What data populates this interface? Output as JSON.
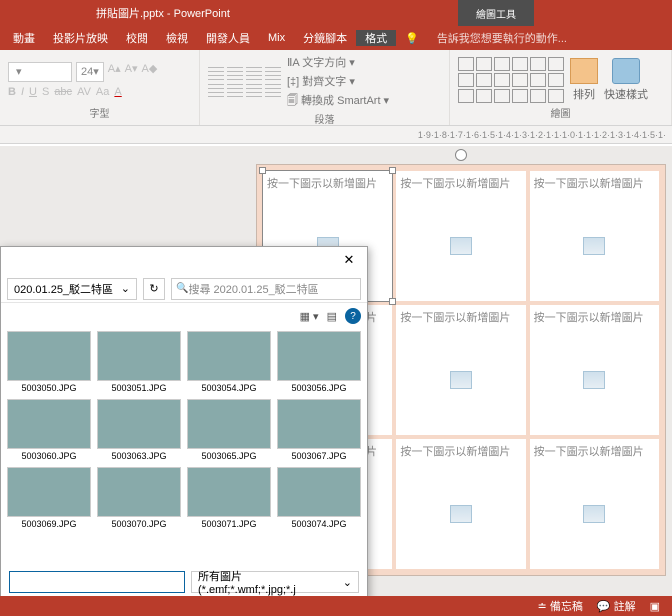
{
  "title": "拼貼圖片.pptx - PowerPoint",
  "tool_tab": "繪圖工具",
  "tabs": {
    "t1": "動畫",
    "t2": "投影片放映",
    "t3": "校閱",
    "t4": "檢視",
    "t5": "開發人員",
    "t6": "Mix",
    "t7": "分鏡腳本",
    "t8": "格式"
  },
  "tellme": "告訴我您想要執行的動作...",
  "ribbon": {
    "font_size": "24",
    "font_group": "字型",
    "para_group": "段落",
    "draw_group": "繪圖",
    "para1": "文字方向",
    "para2": "對齊文字",
    "para3": "轉換成 SmartArt",
    "arrange": "排列",
    "quick": "快速樣式"
  },
  "ruler": "1·9·1·8·1·7·1·6·1·5·1·4·1·3·1·2·1·1·1·0·1·1·1·2·1·3·1·4·1·5·1·",
  "placeholder": "按一下圖示以新增圖片",
  "dialog": {
    "path": "020.01.25_駁二特區",
    "search": "搜尋 2020.01.25_駁二特區",
    "filetype": "所有圖片 (*.emf;*.wmf;*.jpg;*.j",
    "thumbs": [
      "5003050.JPG",
      "5003051.JPG",
      "5003054.JPG",
      "5003056.JPG",
      "5003060.JPG",
      "5003063.JPG",
      "5003065.JPG",
      "5003067.JPG",
      "5003069.JPG",
      "5003070.JPG",
      "5003071.JPG",
      "5003074.JPG"
    ]
  },
  "status": {
    "notes": "備忘稿",
    "comments": "註解"
  }
}
